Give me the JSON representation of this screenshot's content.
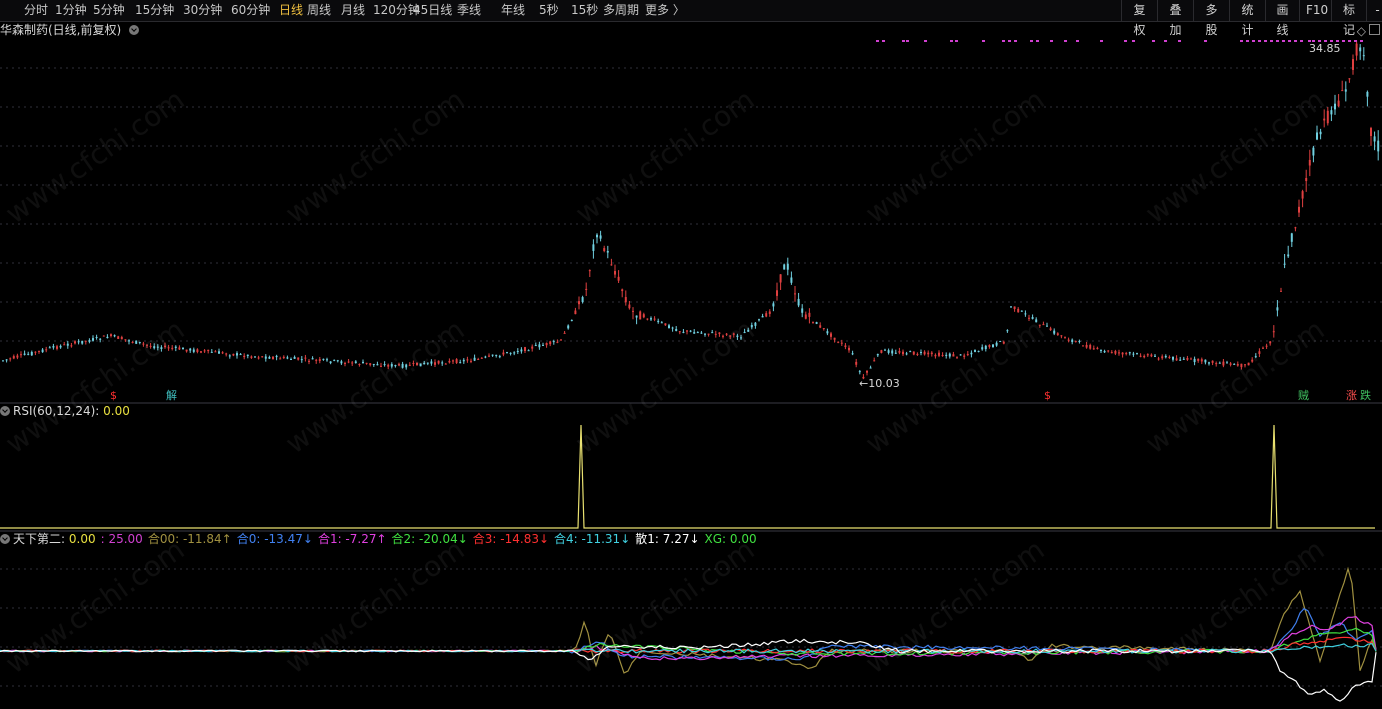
{
  "toolbar": {
    "periods": [
      "分时",
      "1分钟",
      "5分钟",
      "15分钟",
      "30分钟",
      "60分钟",
      "日线",
      "周线",
      "月线",
      "120分钟",
      "45日线",
      "季线",
      "年线",
      "5秒",
      "15秒",
      "多周期",
      "更多 〉"
    ],
    "active_period": "日线",
    "right_buttons": [
      "复权",
      "叠加",
      "多股",
      "统计",
      "画线",
      "F10",
      "标记",
      "-目"
    ]
  },
  "main_panel": {
    "title": "华森制药(日线,前复权)",
    "high_label": "34.85",
    "low_label": "←10.03",
    "markers": [
      {
        "text": "$",
        "color": "#ff3030"
      },
      {
        "text": "解",
        "color": "#40c0c0"
      },
      {
        "text": "$",
        "color": "#ff3030"
      },
      {
        "text": "贼",
        "color": "#40c060"
      },
      {
        "text": "涨",
        "color": "#ff5050"
      },
      {
        "text": "跌",
        "color": "#40c060"
      }
    ]
  },
  "rsi_panel": {
    "title": "RSI(60,12,24)",
    "sep": ":",
    "value": "0.00",
    "line_color": "#e8e070"
  },
  "tianxia_panel": {
    "title": "天下第二",
    "sep": ":",
    "items": [
      {
        "label": "",
        "value": "0.00",
        "color": "#e8e040",
        "arrow": ""
      },
      {
        "label": ":",
        "value": "25.00",
        "color": "#d040d0",
        "arrow": ""
      },
      {
        "label": "合00:",
        "value": "-11.84",
        "color": "#a09040",
        "arrow": "↑"
      },
      {
        "label": "合0:",
        "value": "-13.47",
        "color": "#4080f0",
        "arrow": "↓"
      },
      {
        "label": "合1:",
        "value": "-7.27",
        "color": "#e040e0",
        "arrow": "↑"
      },
      {
        "label": "合2:",
        "value": "-20.04",
        "color": "#40e040",
        "arrow": "↓"
      },
      {
        "label": "合3:",
        "value": "-14.83",
        "color": "#ff3030",
        "arrow": "↓"
      },
      {
        "label": "合4:",
        "value": "-11.31",
        "color": "#40d0e0",
        "arrow": "↓"
      },
      {
        "label": "散1:",
        "value": "7.27",
        "color": "#ffffff",
        "arrow": "↓"
      },
      {
        "label": "XG:",
        "value": "0.00",
        "color": "#40e040",
        "arrow": ""
      }
    ]
  },
  "watermark": "www.cfchi.com",
  "colors": {
    "up": "#e04040",
    "down": "#70d0e0",
    "signal_dot": "#d040d0"
  }
}
